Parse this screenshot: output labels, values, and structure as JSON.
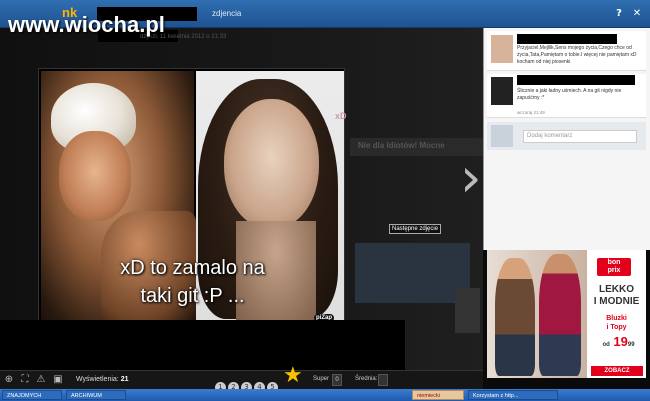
{
  "watermark": "www.wiocha.pl",
  "window": {
    "logo": "nk",
    "title": "zdjencia",
    "help": "?",
    "close": "✕"
  },
  "photo": {
    "meta": "dzyszl. 11 kwietnia 2012 o 21:33",
    "caption_line1": "xD to zamalo na",
    "caption_line2": "taki git :P ...",
    "corner_mark": "xD",
    "pizap": "piZap",
    "next_link": "Następne zdjęcie",
    "background_banner": "Nie dla Idiotów! Mocne"
  },
  "toolbar": {
    "views_label": "Wyświetlenia:",
    "views_count": "21",
    "super_label": "Super",
    "super_value": "0",
    "average_label": "Średnia:"
  },
  "comments": [
    {
      "text": "Przyjaciel,Mejllik,Sens mojego życia,Czego chce od życia,Tata,Pamiętam o tobie.I więcej nie pamiętam xD kocham od niej piosenki"
    },
    {
      "text": "Ślicznie a jaki ładny uśmiech. A na git nigdy nie zapuśćmy :*",
      "time": "wczoraj 21:49"
    }
  ],
  "add_comment": {
    "placeholder": "Dodaj komentarz"
  },
  "ad": {
    "brand_line1": "bon",
    "brand_line2": "prix",
    "headline_line1": "LEKKO",
    "headline_line2": "I MODNIE",
    "subline_line1": "Bluzki",
    "subline_line2": "i Topy",
    "price_prefix": "od",
    "price": "19",
    "price_cents": "99",
    "button": "ZOBACZ"
  },
  "taskbar": {
    "items": [
      "ZNAJOMYCH",
      "ARCHIWUM",
      "niemiecki GRATIS»",
      "Korzystam z http..."
    ]
  }
}
